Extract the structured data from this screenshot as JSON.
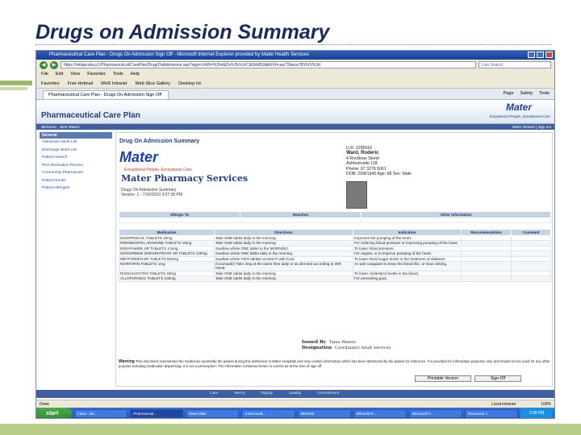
{
  "slide": {
    "title": "Drugs on Admission Summary"
  },
  "browser": {
    "window_title": "Pharmaceutical Care Plan - Drugs On Admission Sign Off - Microsoft Internet Explorer provided by Mater Health Services",
    "address": "https://mtlapcubuu:1/Pharmaceutical/CarePlan/Drug/OnAdmission.asp?sign=1#MI=%2b4&Dv%2bVvXC&0ldd5SbbhIVt=use?2bene7BYiVV%3d",
    "search_placeholder": "Live Search",
    "menu": [
      "File",
      "Edit",
      "View",
      "Favorites",
      "Tools",
      "Help"
    ],
    "favorites": [
      "Favorites",
      "Free Hotmail",
      "MHS Intranet",
      "Web Slice Gallery",
      "Desktop Int"
    ],
    "tab_label": "Pharmaceutical Care Plan - Drugs On Admission Sign Off",
    "tab_tools": [
      "Page",
      "Safety",
      "Tools"
    ],
    "status_text": "Done",
    "status_zone": "Local intranet",
    "zoom": "100%"
  },
  "app": {
    "title": "Pharmaceutical Care Plan",
    "logo": "Mater",
    "tagline": "Exceptional People. Exceptional Care.",
    "nav_left": "Welcome - Jane Waters",
    "nav_right": "Mater Intranet | Sign out",
    "sidebar_head": "General",
    "sidebar_items": [
      "Admission Work List",
      "Discharge Work List",
      "Patient Search",
      "Pick Medication Review",
      "Community Pharmacies",
      "Patient Books",
      "Patient Allergies"
    ],
    "footer_links": [
      "Care",
      "Mercy",
      "Dignity",
      "Quality",
      "Commitment"
    ]
  },
  "doc": {
    "title": "Drug On Admission Summary",
    "logo": "Mater",
    "logo_tag": "Exceptional People. Exceptional Care.",
    "service": "Mater Pharmacy Services",
    "sub1": "Drugs On Admission Summary",
    "sub2": "Version: 1 - 7/10/2010 3:07:38 PM",
    "patient": {
      "ur": "U.R. 2295916",
      "name": "Ward, Roderic",
      "addr1": "4 Rockleas Street",
      "addr2": "Ashburnside 118",
      "phone": "Phone: 07 3278 5061",
      "dob": "DOB: 20/8/1940 Age: 68 Sex: Male"
    },
    "allergy_headers": [
      "Allergic To",
      "Reaction",
      "Other Information"
    ],
    "med_headers": [
      "Medication",
      "Directions",
      "Indication",
      "Recommendation",
      "Comment"
    ],
    "meds": [
      {
        "med": "DISOPROCOL TABLETS 10mg",
        "dir": "Take ONE tablet daily in the morning.",
        "ind": "Improves the pumping of the heart."
      },
      {
        "med": "PERINDOPRIL ARGININE TABLETS 10mg",
        "dir": "Take ONE tablet daily in the morning.",
        "ind": "For reducing blood pressure or improving pumping of the heart."
      },
      {
        "med": "INDAPAMIDE SR TABLETS 1.5mg",
        "dir": "Swallow whole ONE tablet in the MORNING.",
        "ind": "To lower blood pressure."
      },
      {
        "med": "ISOSORBIDE MONONITRATE SR TABLETS 120mg",
        "dir": "Swallow whole ONE tablet daily in the morning.",
        "ind": "For angina, or to improve pumping of the heart."
      },
      {
        "med": "METFORMIN ER TABLETS 500mg",
        "dir": "Swallow whole TWO tablets at NIGHT with food.",
        "ind": "To lower blood sugar levels in the treatment of diabetes."
      },
      {
        "med": "WARFARIN TABLETS 1mg",
        "dir": "(Coumadin) Take 3mg at the same time daily or as directed according to INR result.",
        "ind": "An anti-coagulant to keep the blood thin, or slow clotting."
      },
      {
        "med": "ROSUVASTATIN TABLETS 40mg",
        "dir": "Take ONE tablet daily in the morning.",
        "ind": "To lower cholesterol levels in the blood."
      },
      {
        "med": "ALLOPURINOL TABLETS 100mg",
        "dir": "Take ONE tablet daily in the morning.",
        "ind": "For preventing gout."
      }
    ],
    "issued_label": "Issued By",
    "issued_value": "Tania Waters",
    "designation_label": "Designation",
    "designation_value": "Coordinator Adult Services",
    "warning_label": "Warning",
    "warning_text": "This document summarises the medicines reportedly the patient during this admission to Mater Hospitals and may contain information which has been abstracted by the patient for reference. It is provided for information purposes only and should not be used for any other purpose including medication dispensing. It is not a prescription. The information contained herein is current as at the time of sign off.",
    "print_button": "Printable Version",
    "sign_button": "Sign-Off"
  },
  "taskbar": {
    "start": "start",
    "tasks": [
      "Inbox - Mi...",
      "Pharmaceutl...",
      "NewFolder",
      "3 Microsoft...",
      "MRInvld",
      "MRInvld R...",
      "Microsoft P...",
      "Document 1"
    ],
    "clock": "3:09 PM"
  }
}
